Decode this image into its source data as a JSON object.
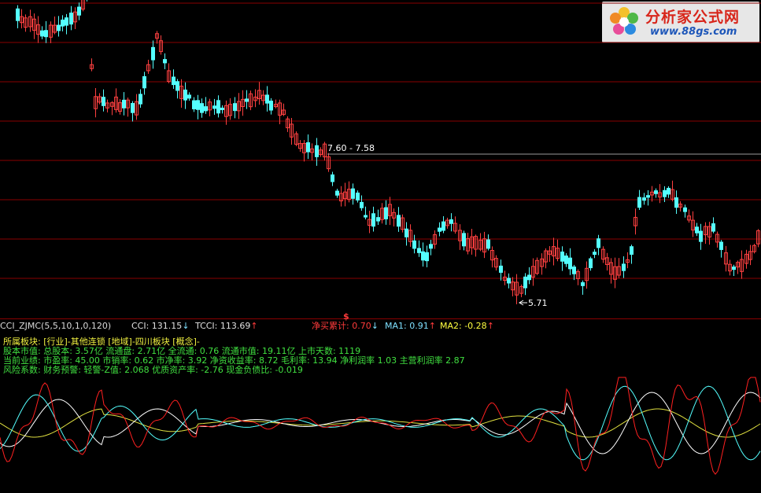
{
  "watermark": {
    "title": "分析家公式网",
    "url": "www.88gs.com"
  },
  "price_chart": {
    "annotations": {
      "high_label": "7.60 - 7.58",
      "low_label": "5.71"
    }
  },
  "indicator_header": {
    "name": "CCI_ZJMC(5,5,10,1,0,120)",
    "cci": "CCI: 131.15",
    "cci_arrow": "↓",
    "tcci": "TCCI: 113.69",
    "tcci_arrow": "↑",
    "net_buy": "净买累计: 0.70",
    "net_buy_arrow": "↓",
    "ma1": "MA1: 0.91",
    "ma1_arrow": "↑",
    "ma2": "MA2: -0.28",
    "ma2_arrow": "↑",
    "dollar": "$"
  },
  "info_lines": [
    "所属板块: [行业]-其他连锁 [地域]-四川板块 [概念]-",
    "股本市值: 总股本: 3.57亿 流通盘: 2.71亿 全流通: 0.76 流通市值: 19.11亿 上市天数: 1119",
    "当前业绩: 市盈率: 45.00 市销率: 0.62 市净率: 3.92 净资收益率: 8.72 毛利率: 13.94 净利润率 1.03 主营利润率 2.87",
    "风险系数: 财务预警: 轻警-Z值: 2.068 优质资产率: -2.76 现金负债比: -0.019"
  ],
  "colors": {
    "background": "#000000",
    "up_candle": "#ff4040",
    "down_candle": "#54ffff",
    "grid": "#8a0000",
    "header_name": "#d8d8d8",
    "header_cci": "#e0e0e0",
    "header_net": "#ff3b3b",
    "header_ma1": "#7ee0ff",
    "header_ma2": "#ffff40",
    "info_yellow": "#f0f040",
    "info_green": "#40e040",
    "line_white": "#ffffff",
    "line_cyan": "#54ffff",
    "line_yellow": "#e0e040",
    "line_red": "#ff2020"
  }
}
